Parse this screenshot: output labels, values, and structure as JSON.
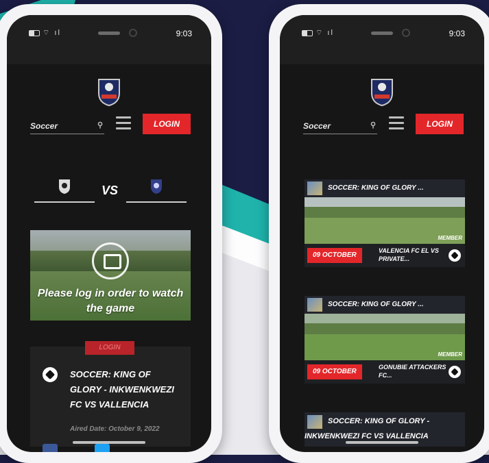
{
  "status_bar": {
    "time": "9:03"
  },
  "search": {
    "placeholder": "Soccer"
  },
  "header": {
    "login_label": "LOGIN"
  },
  "match": {
    "vs_label": "VS"
  },
  "video": {
    "lock_message": "Please log in order to watch the game",
    "login_label": "LOGIN"
  },
  "info_card": {
    "title": "SOCCER: KING OF GLORY - INKWENKWEZI FC VS VALLENCIA",
    "aired_date": "Aired Date: October 9, 2022"
  },
  "list": {
    "cards": [
      {
        "header": "SOCCER: KING OF GLORY ...",
        "badge": "MEMBER",
        "date": "09 OCTOBER",
        "match": "VALENCIA FC EL VS PRIVATE..."
      },
      {
        "header": "SOCCER: KING OF GLORY ...",
        "badge": "MEMBER",
        "date": "09 OCTOBER",
        "match": "GONUBIE ATTACKERS FC..."
      }
    ],
    "third_card": {
      "line1": "SOCCER: KING OF GLORY -",
      "line2": "INKWENKWEZI FC VS VALLENCIA"
    }
  },
  "colors": {
    "accent": "#e3262a",
    "background": "#1b1d45",
    "stripe": "#1fb3ac"
  }
}
